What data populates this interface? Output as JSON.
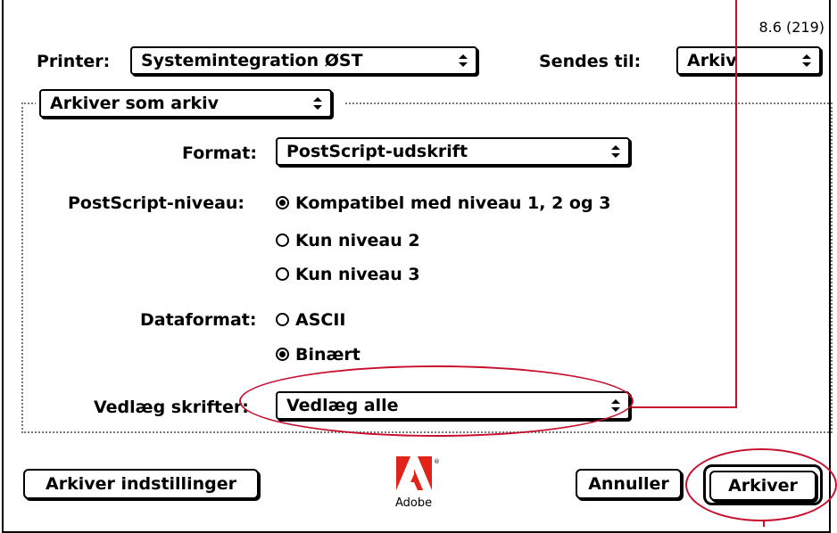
{
  "version": "8.6 (219)",
  "printer": {
    "label": "Printer:",
    "value": "Systemintegration ØST"
  },
  "destination": {
    "label": "Sendes til:",
    "value": "Arkiv"
  },
  "panel_popup": {
    "value": "Arkiver som arkiv"
  },
  "format": {
    "label": "Format:",
    "value": "PostScript-udskrift"
  },
  "postscript_level": {
    "label": "PostScript-niveau:",
    "options": [
      "Kompatibel med niveau 1, 2 og 3",
      "Kun niveau 2",
      "Kun niveau 3"
    ],
    "selected_index": 0
  },
  "data_format": {
    "label": "Dataformat:",
    "options": [
      "ASCII",
      "Binært"
    ],
    "selected_index": 1
  },
  "embed_fonts": {
    "label": "Vedlæg skrifter:",
    "value": "Vedlæg alle"
  },
  "buttons": {
    "save_settings": "Arkiver indstillinger",
    "cancel": "Annuller",
    "save": "Arkiver"
  },
  "logo": {
    "wordmark": "Adobe",
    "mark": "®"
  },
  "colors": {
    "annotation": "#c8102e",
    "logo": "#e2231a"
  },
  "icons": {
    "popup_arrow": "up-down-arrows-icon",
    "logo": "adobe-logo-icon"
  }
}
